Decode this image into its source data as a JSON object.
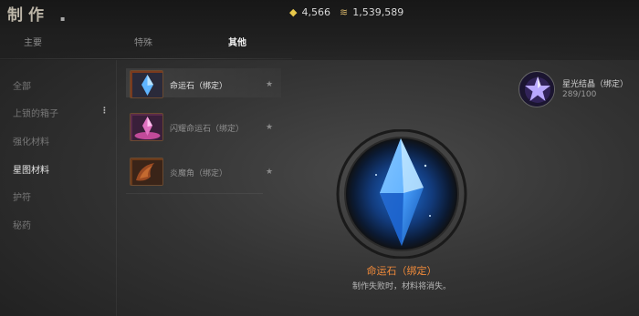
{
  "header": {
    "title": "制作",
    "currency": [
      {
        "icon": "lightning-gem-icon",
        "value": "4,566"
      },
      {
        "icon": "gold-coins-icon",
        "value": "1,539,589"
      }
    ]
  },
  "tabs": [
    {
      "label": "主要",
      "active": false
    },
    {
      "label": "特殊",
      "active": false
    },
    {
      "label": "其他",
      "active": true
    }
  ],
  "sidebar": {
    "items": [
      {
        "label": "全部",
        "active": false
      },
      {
        "label": "上锁的箱子",
        "active": false
      },
      {
        "label": "强化材料",
        "active": false
      },
      {
        "label": "星图材料",
        "active": true
      },
      {
        "label": "护符",
        "active": false
      },
      {
        "label": "秘药",
        "active": false
      }
    ]
  },
  "recipe_list": [
    {
      "name": "命运石（绑定）",
      "active": true,
      "icon": "fate-stone-icon"
    },
    {
      "name": "闪耀命运石（绑定）",
      "active": false,
      "icon": "shining-fate-stone-icon"
    },
    {
      "name": "炎魔角（绑定）",
      "active": false,
      "icon": "flame-demon-horn-icon"
    }
  ],
  "selected": {
    "name": "命运石（绑定）",
    "note": "制作失败时，材料将消失。"
  },
  "material": {
    "name": "星光结晶（绑定）",
    "count": "289/100",
    "icon": "starlight-crystal-icon"
  },
  "colors": {
    "accent_orange": "#f08a3a",
    "crystal_blue": "#4aa2ff"
  }
}
